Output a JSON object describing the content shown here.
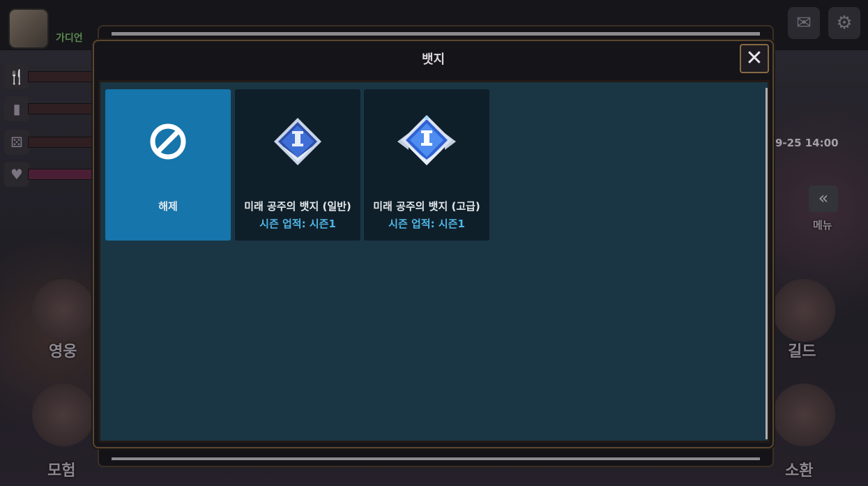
{
  "background": {
    "player_name": "가디언",
    "timestamp": "9-25 14:00",
    "side_labels": [
      "영웅",
      "모험",
      "길드",
      "소환",
      "메뉴"
    ]
  },
  "modal": {
    "title": "뱃지",
    "close_label": "✕",
    "badges": [
      {
        "name": "해제",
        "subtitle": "",
        "selected": true,
        "icon": "prohibited-icon"
      },
      {
        "name": "미래 공주의 뱃지 (일반)",
        "subtitle": "시즌 업적: 시즌1",
        "selected": false,
        "icon": "badge-normal-icon"
      },
      {
        "name": "미래 공주의 뱃지 (고급)",
        "subtitle": "시즌 업적: 시즌1",
        "selected": false,
        "icon": "badge-advanced-icon"
      }
    ]
  },
  "colors": {
    "selected_card": "#1675ab",
    "card": "#0f1f29",
    "content_bg": "#1a3645",
    "subtitle": "#4fb6e6"
  }
}
